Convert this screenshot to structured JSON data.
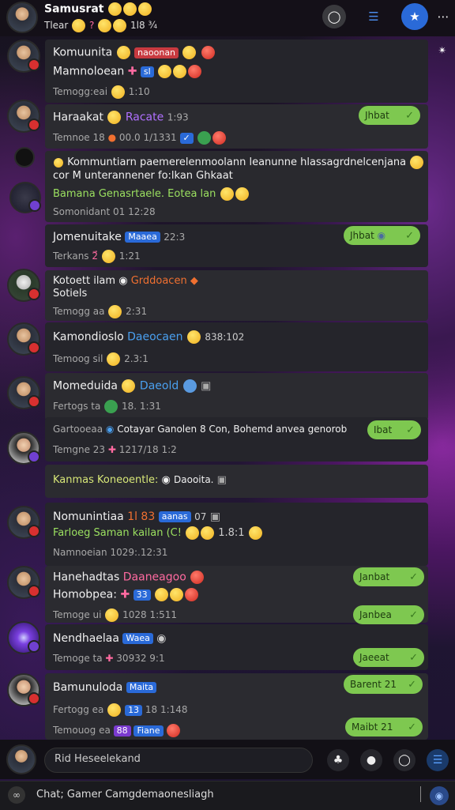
{
  "header": {
    "title": "Samusrat",
    "subtitle": "Tlear",
    "subtitle_tail": "1l8 ¾"
  },
  "messages": [
    {
      "line1": "Komuunita",
      "tag1": "naoonan",
      "line2": "Mamnoloean",
      "tag2": "sl",
      "meta": "Temogg:eai",
      "time": "1:10"
    },
    {
      "line1": "Haraakat",
      "tag1": "Racate",
      "time1": "1:93",
      "meta": "Temnoe 18",
      "meta2": "00.0 1/1331",
      "pill": "Jhbat"
    },
    {
      "line1": "Kommuntiarn paemerelenmoolann leanunne hlassagrdnelcenjana",
      "line2": "cor M unterannener fo:lkan Ghkaat",
      "line3": "Bamana Genasrtaele. Eotea lan",
      "meta": "Somonidant 01 12:28"
    },
    {
      "line1": "Jomenuitake",
      "tag1": "Maaea",
      "time1": "22:3",
      "meta": "Terkans",
      "time": "1:21",
      "pill": "Jhbat"
    },
    {
      "line1": "Kotoett ilam",
      "tag1": "Grddoacen",
      "line2": "Sotiels",
      "meta": "Temogg aa",
      "time": "2:31"
    },
    {
      "line1": "Kamondioslo",
      "tag1": "Daeocaen",
      "time1": "838:102",
      "meta": "Temoog sil",
      "time": "2.3:1"
    },
    {
      "line1": "Momeduida",
      "tag1": "Daeold",
      "meta": "Fertogs ta",
      "time": "18. 1:31"
    },
    {
      "line1": "Gartooeaa",
      "line1b": "Cotayar Ganolen 8 Con, Bohemd anvea genorob",
      "meta": "Temgne 23",
      "time": "1217/18 1:2",
      "pill": "Ibat"
    },
    {
      "line1": "Kanmas Koneoentle:",
      "tag1": "Daooita."
    },
    {
      "line1": "Nomunintiaa",
      "tag1": "1l 83",
      "tag2": "aanas",
      "time1": "07",
      "line2": "Farloeg Saman kailan (C!",
      "time2": "1.8:1",
      "meta": "Namnoeian 1029:.12:31"
    },
    {
      "line1": "Hanehadtas",
      "tag1": "Daaneagoo",
      "line2": "Homobpea:",
      "tag2": "33",
      "meta": "Temoge ui",
      "time": "1028 1:511",
      "pill1": "Janbat",
      "pill2": "Janbea"
    },
    {
      "line1": "Nendhaelaa",
      "tag1": "Waea",
      "meta": "Temoge ta",
      "time": "30932 9:1",
      "pill": "Jaeeat"
    },
    {
      "line1": "Bamunuloda",
      "tag1": "Maita",
      "meta": "Fertogg ea",
      "time": "18 1:148",
      "meta2": "Temouog ea",
      "tag2": "Fiane",
      "pill1": "Barent 21",
      "pill2": "Maibt 21"
    }
  ],
  "composer": {
    "placeholder": "Rid Heseelekand"
  },
  "footer": {
    "text": "Chat; Gamer Camgdemaonesliagh"
  },
  "colors": {
    "accent_green": "#7ec850",
    "accent_blue": "#2a6ad8",
    "background": "#1a1428"
  }
}
